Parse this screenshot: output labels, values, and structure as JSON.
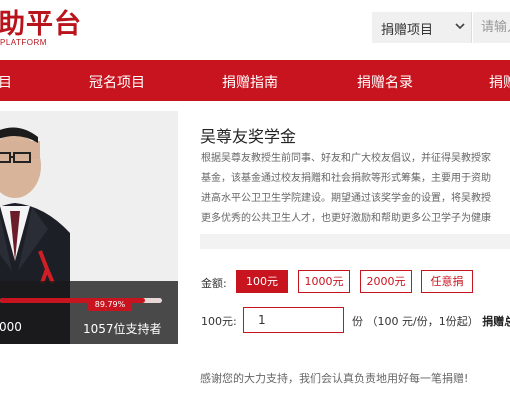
{
  "header": {
    "logo_cn": "助平台",
    "logo_en": "PLATFORM",
    "select_value": "捐赠项目",
    "search_placeholder": "请输入"
  },
  "nav": {
    "items": [
      "目",
      "冠名项目",
      "捐赠指南",
      "捐赠名录",
      "捐赠用"
    ]
  },
  "project": {
    "raised": "000",
    "supporters": "1057位支持者",
    "progress_percent_label": "89.79%",
    "progress_percent": 89.79,
    "title": "吴尊友奖学金",
    "desc_lines": [
      "根据吴尊友教授生前同事、好友和广大校友倡议，并征得吴教授家",
      "基金，该基金通过校友捐赠和社会捐款等形式筹集，主要用于资助",
      "进高水平公卫卫生学院建设。期望通过该奖学金的设置，将吴教授",
      "更多优秀的公共卫生人才，也更好激励和帮助更多公卫学子为健康"
    ]
  },
  "donate": {
    "amount_label": "金额:",
    "amounts": [
      "100元",
      "1000元",
      "2000元",
      "任意捐"
    ],
    "selected_index": 0,
    "qty_label": "100元:",
    "qty_value": "1",
    "unit_text": "份  （100 元/份，1份起）",
    "total_label": "捐赠总金",
    "thanks": "感谢您的大力支持，我们会认真负责地用好每一笔捐赠!"
  },
  "colors": {
    "brand_red": "#c8141f"
  }
}
